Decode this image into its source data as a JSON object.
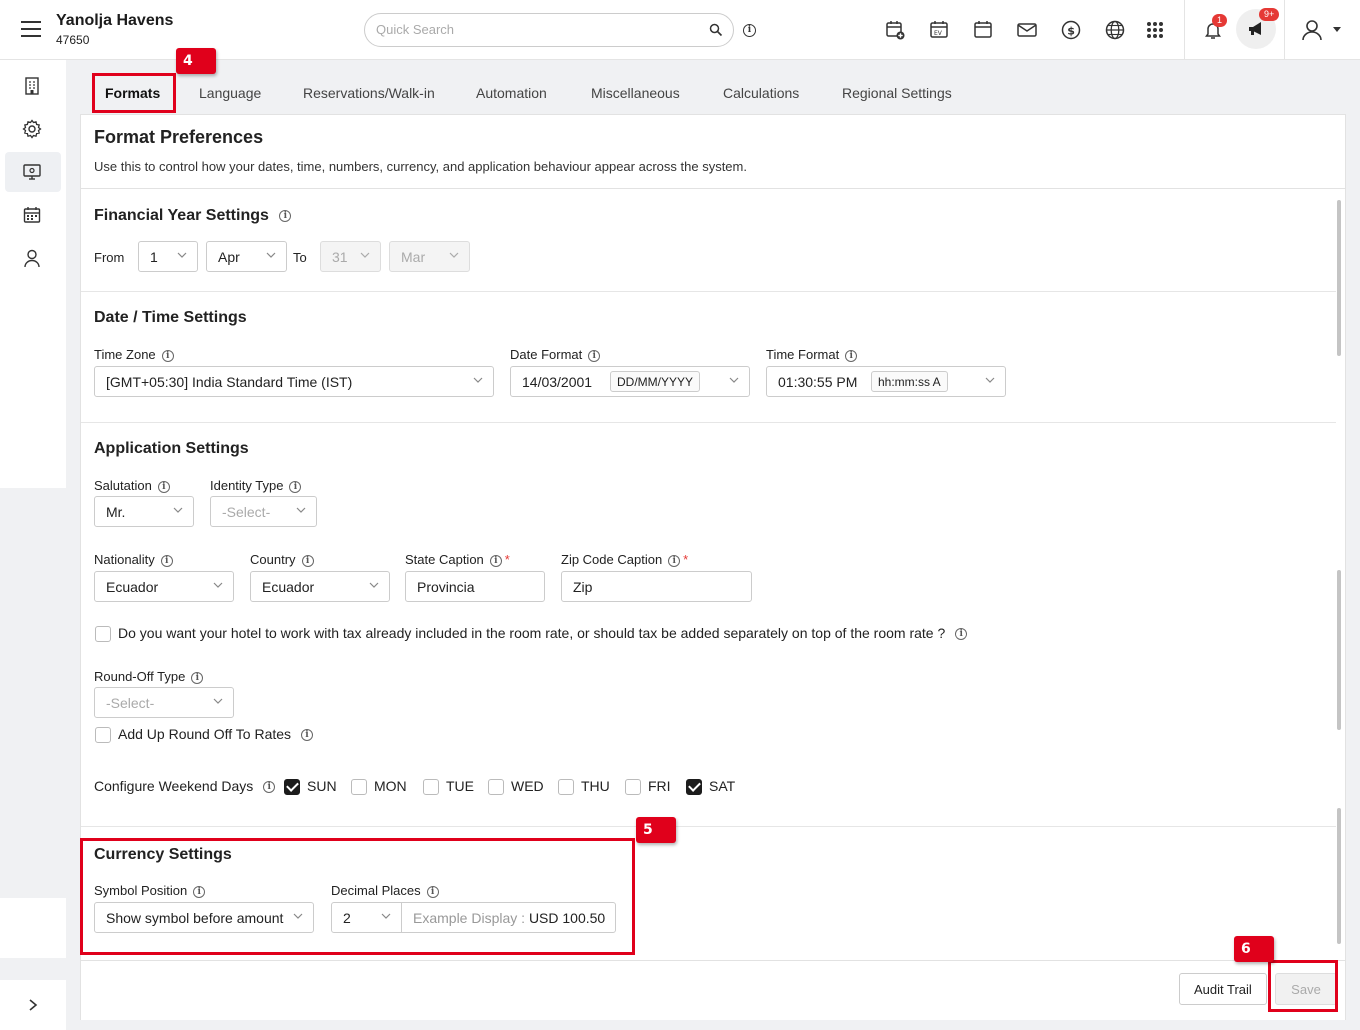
{
  "header": {
    "hotel_name": "Yanolja Havens",
    "hotel_id": "47650",
    "search_placeholder": "Quick Search",
    "notification_count": "1",
    "announcement_count": "9+"
  },
  "tabs": [
    {
      "label": "Formats",
      "active": true
    },
    {
      "label": "Language"
    },
    {
      "label": "Reservations/Walk-in"
    },
    {
      "label": "Automation"
    },
    {
      "label": "Miscellaneous"
    },
    {
      "label": "Calculations"
    },
    {
      "label": "Regional Settings"
    }
  ],
  "annotations": {
    "step4": "4",
    "step5": "5",
    "step6": "6"
  },
  "page": {
    "title": "Format Preferences",
    "subtitle": "Use this to control how your dates, time, numbers, currency, and application behaviour appear across the system."
  },
  "financial_year": {
    "title": "Financial Year Settings",
    "from_label": "From",
    "to_label": "To",
    "from_day": "1",
    "from_month": "Apr",
    "to_day": "31",
    "to_month": "Mar"
  },
  "datetime": {
    "title": "Date / Time Settings",
    "timezone_label": "Time Zone",
    "timezone_value": "[GMT+05:30] India Standard Time (IST)",
    "date_format_label": "Date Format",
    "date_example": "14/03/2001",
    "date_format": "DD/MM/YYYY",
    "time_format_label": "Time Format",
    "time_example": "01:30:55 PM",
    "time_format": "hh:mm:ss A"
  },
  "application": {
    "title": "Application Settings",
    "salutation_label": "Salutation",
    "salutation_value": "Mr.",
    "identity_label": "Identity Type",
    "identity_value": "-Select-",
    "nationality_label": "Nationality",
    "nationality_value": "Ecuador",
    "country_label": "Country",
    "country_value": "Ecuador",
    "state_label": "State Caption",
    "state_value": "Provincia",
    "zip_label": "Zip Code Caption",
    "zip_value": "Zip",
    "tax_question": "Do you want your hotel to work with tax already included in the room rate, or should tax be added separately on top of the room rate ?",
    "roundoff_label": "Round-Off Type",
    "roundoff_value": "-Select-",
    "add_roundoff_label": "Add Up Round Off To Rates",
    "weekend_label": "Configure Weekend Days",
    "weekend_days": [
      {
        "label": "SUN",
        "checked": true
      },
      {
        "label": "MON",
        "checked": false
      },
      {
        "label": "TUE",
        "checked": false
      },
      {
        "label": "WED",
        "checked": false
      },
      {
        "label": "THU",
        "checked": false
      },
      {
        "label": "FRI",
        "checked": false
      },
      {
        "label": "SAT",
        "checked": true
      }
    ]
  },
  "currency": {
    "title": "Currency Settings",
    "symbol_label": "Symbol Position",
    "symbol_value": "Show symbol before amount",
    "decimal_label": "Decimal Places",
    "decimal_value": "2",
    "example_label": "Example Display :",
    "example_value": "USD 100.50"
  },
  "footer": {
    "audit_label": "Audit Trail",
    "save_label": "Save"
  },
  "colors": {
    "highlight": "#e0001b",
    "badge": "#e53935"
  }
}
